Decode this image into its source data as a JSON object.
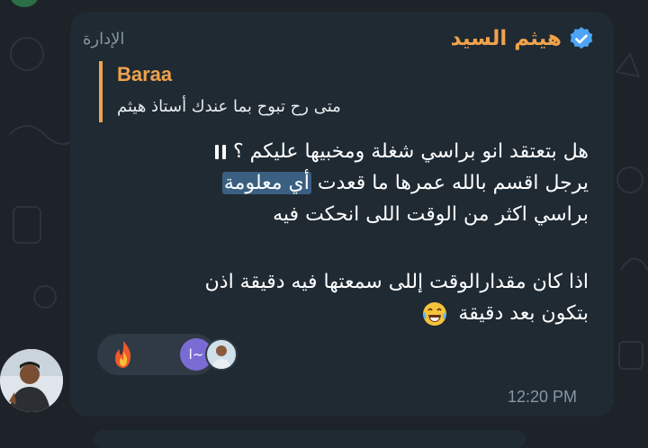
{
  "message": {
    "sender_name": "هيثم السيد",
    "admin_label": "الإدارة",
    "reply": {
      "author": "Baraa",
      "text": "متى رح تبوح بما عندك أستاذ هيثم"
    },
    "lines": {
      "l1": "هل بتعتقد انو براسي شغلة ومخبيها عليكم ؟",
      "l2_pre": "يرجل اقسم بالله عمرها ما قعدت ",
      "l2_highlight": "أي معلومة",
      "l3": "براسي اكثر من الوقت اللى انحكت فيه",
      "l4": "اذا كان مقدارالوقت إللى سمعتها فيه دقيقة اذن",
      "l5": "بتكون بعد دقيقة"
    },
    "reactions": {
      "emoji": "fire-icon",
      "avatar_initials": "ا~"
    },
    "time": "12:20 PM"
  },
  "colors": {
    "background": "#1d2328",
    "bubble": "#1f2a33",
    "accent": "#f0a24c",
    "highlight": "#3a5f80",
    "muted": "#8697a3"
  }
}
